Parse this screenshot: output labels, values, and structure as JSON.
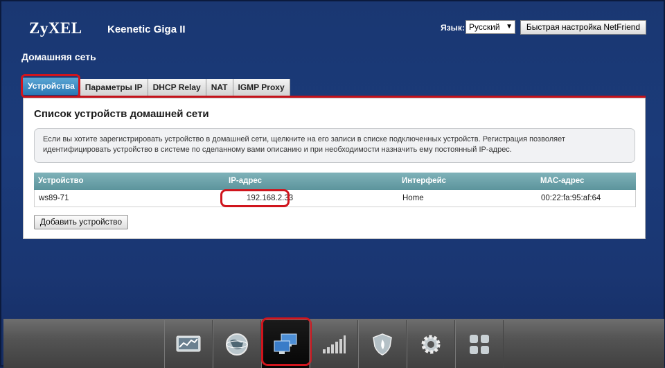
{
  "header": {
    "brand": "ZyXEL",
    "model": "Keenetic Giga II",
    "language_label": "Язык:",
    "language_value": "Русский",
    "quick_setup_label": "Быстрая настройка NetFriend"
  },
  "page": {
    "title": "Домашняя сеть"
  },
  "tabs": [
    {
      "label": "Устройства",
      "active": true
    },
    {
      "label": "Параметры IP",
      "active": false
    },
    {
      "label": "DHCP Relay",
      "active": false
    },
    {
      "label": "NAT",
      "active": false
    },
    {
      "label": "IGMP Proxy",
      "active": false
    }
  ],
  "panel": {
    "title": "Список устройств домашней сети",
    "info_text": "Если вы хотите зарегистрировать устройство в домашней сети, щелкните на его записи в списке подключенных устройств. Регистрация позволяет идентифицировать устройство в системе по сделанному вами описанию и при необходимости назначить ему постоянный IP-адрес."
  },
  "table": {
    "headers": [
      "Устройство",
      "IP-адрес",
      "Интерфейс",
      "MAC-адрес"
    ],
    "rows": [
      [
        "ws89-71",
        "192.168.2.33",
        "Home",
        "00:22:fa:95:af:64"
      ]
    ]
  },
  "actions": {
    "add_device_label": "Добавить устройство"
  },
  "dock": {
    "items": [
      {
        "icon": "monitor-graph-icon",
        "active": false
      },
      {
        "icon": "globe-icon",
        "active": false
      },
      {
        "icon": "home-network-icon",
        "active": true
      },
      {
        "icon": "wifi-signal-icon",
        "active": false
      },
      {
        "icon": "shield-icon",
        "active": false
      },
      {
        "icon": "gear-icon",
        "active": false
      },
      {
        "icon": "apps-grid-icon",
        "active": false
      }
    ]
  },
  "colors": {
    "background": "#1b3b7a",
    "active_tab": "#2a77b4",
    "accent_red": "#c4121a",
    "table_header": "#6fa4ab"
  }
}
